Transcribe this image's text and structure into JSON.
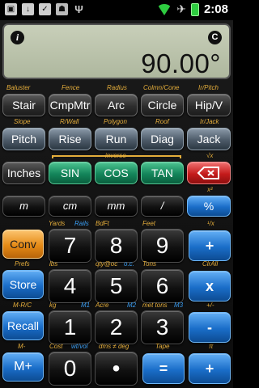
{
  "status_bar": {
    "time": "2:08",
    "notification_icons": [
      "image-icon",
      "download-icon",
      "check-icon",
      "android-icon",
      "usb-icon"
    ],
    "system_icons": [
      "wifi-icon",
      "airplane-icon",
      "battery-icon"
    ]
  },
  "display": {
    "info_label": "i",
    "clear_label": "C",
    "value": "90.00°"
  },
  "rows": {
    "row1": {
      "labels": [
        "Baluster",
        "Fence",
        "Radius",
        "Colmn/Cone",
        "Ir/Pitch"
      ],
      "keys": [
        "Stair",
        "CmpMtr",
        "Arc",
        "Circle",
        "Hip/V"
      ]
    },
    "row2": {
      "labels": [
        "Slope",
        "R/Wall",
        "Polygon",
        "Roof",
        "Ir/Jack"
      ],
      "keys": [
        "Pitch",
        "Rise",
        "Run",
        "Diag",
        "Jack"
      ]
    },
    "row3": {
      "labels": [
        "inverse",
        "√x"
      ],
      "keys": [
        "Inches",
        "SIN",
        "COS",
        "TAN"
      ]
    },
    "row4": {
      "labels": [
        "x²"
      ],
      "keys": [
        "m",
        "cm",
        "mm",
        "/",
        "%"
      ]
    },
    "row5": {
      "labels": [
        "Yards",
        "Rails",
        "BdFt",
        "Feet",
        "¹/x"
      ],
      "keys": [
        "Conv",
        "7",
        "8",
        "9",
        "+"
      ]
    },
    "row6": {
      "labels": [
        "Prefs",
        "lbs",
        "qty@oc",
        "o.c.",
        "Tons",
        "ClrAll"
      ],
      "keys": [
        "Store",
        "4",
        "5",
        "6",
        "x"
      ]
    },
    "row7": {
      "labels": [
        "M-R/C",
        "kg",
        "M1",
        "Acre",
        "M2",
        "met tons",
        "M3",
        "+/-"
      ],
      "keys": [
        "Recall",
        "1",
        "2",
        "3",
        "-"
      ]
    },
    "row8": {
      "labels": [
        "M-",
        "Cost",
        "wt/vol",
        "dms ≠ deg",
        "Tape",
        "π"
      ],
      "keys": [
        "M+",
        "0",
        "•",
        "=",
        "+"
      ]
    }
  },
  "colors": {
    "label_orange": "#e4ad3b",
    "label_blue": "#3a9cf0",
    "green_key": "#14855a",
    "red_key": "#c41b1b",
    "blue_key": "#1a6dc8",
    "orange_key": "#e58a16"
  }
}
